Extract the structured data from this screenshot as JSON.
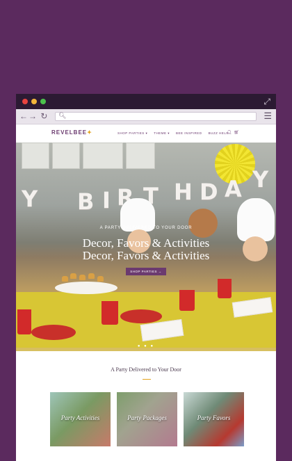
{
  "browser": {
    "buttons": [
      "close",
      "minimize",
      "maximize"
    ],
    "expand_icon": "expand-icon",
    "nav_icons": [
      "back-arrow-icon",
      "forward-arrow-icon",
      "reload-icon"
    ],
    "search_icon": "search-icon",
    "menu_icon": "hamburger-icon"
  },
  "site": {
    "logo": "REVELBEE",
    "nav": [
      {
        "label": "SHOP PARTIES ▾"
      },
      {
        "label": "THEME ▾"
      },
      {
        "label": "BEE INSPIRED"
      },
      {
        "label": "BUZZ HELP"
      }
    ],
    "icons": [
      "user-icon",
      "cart-icon"
    ]
  },
  "hero": {
    "banner_letters": [
      "Y",
      "B",
      "I",
      "R",
      "T",
      "H",
      "D",
      "A",
      "Y"
    ],
    "eyebrow": "A PARTY DELIVERED TO YOUR DOOR",
    "title": "Decor, Favors & Activities",
    "cta": "SHOP PARTIES →",
    "carousel_dots": "● ● ●"
  },
  "section": {
    "title": "A Party Delivered to Your Door"
  },
  "cards": [
    {
      "label": "Party Activities"
    },
    {
      "label": "Party Packages"
    },
    {
      "label": "Party Favors"
    }
  ],
  "colors": {
    "page_bg": "#5b2a5e",
    "brand": "#6b3a6f",
    "accent": "#e3a21c"
  }
}
